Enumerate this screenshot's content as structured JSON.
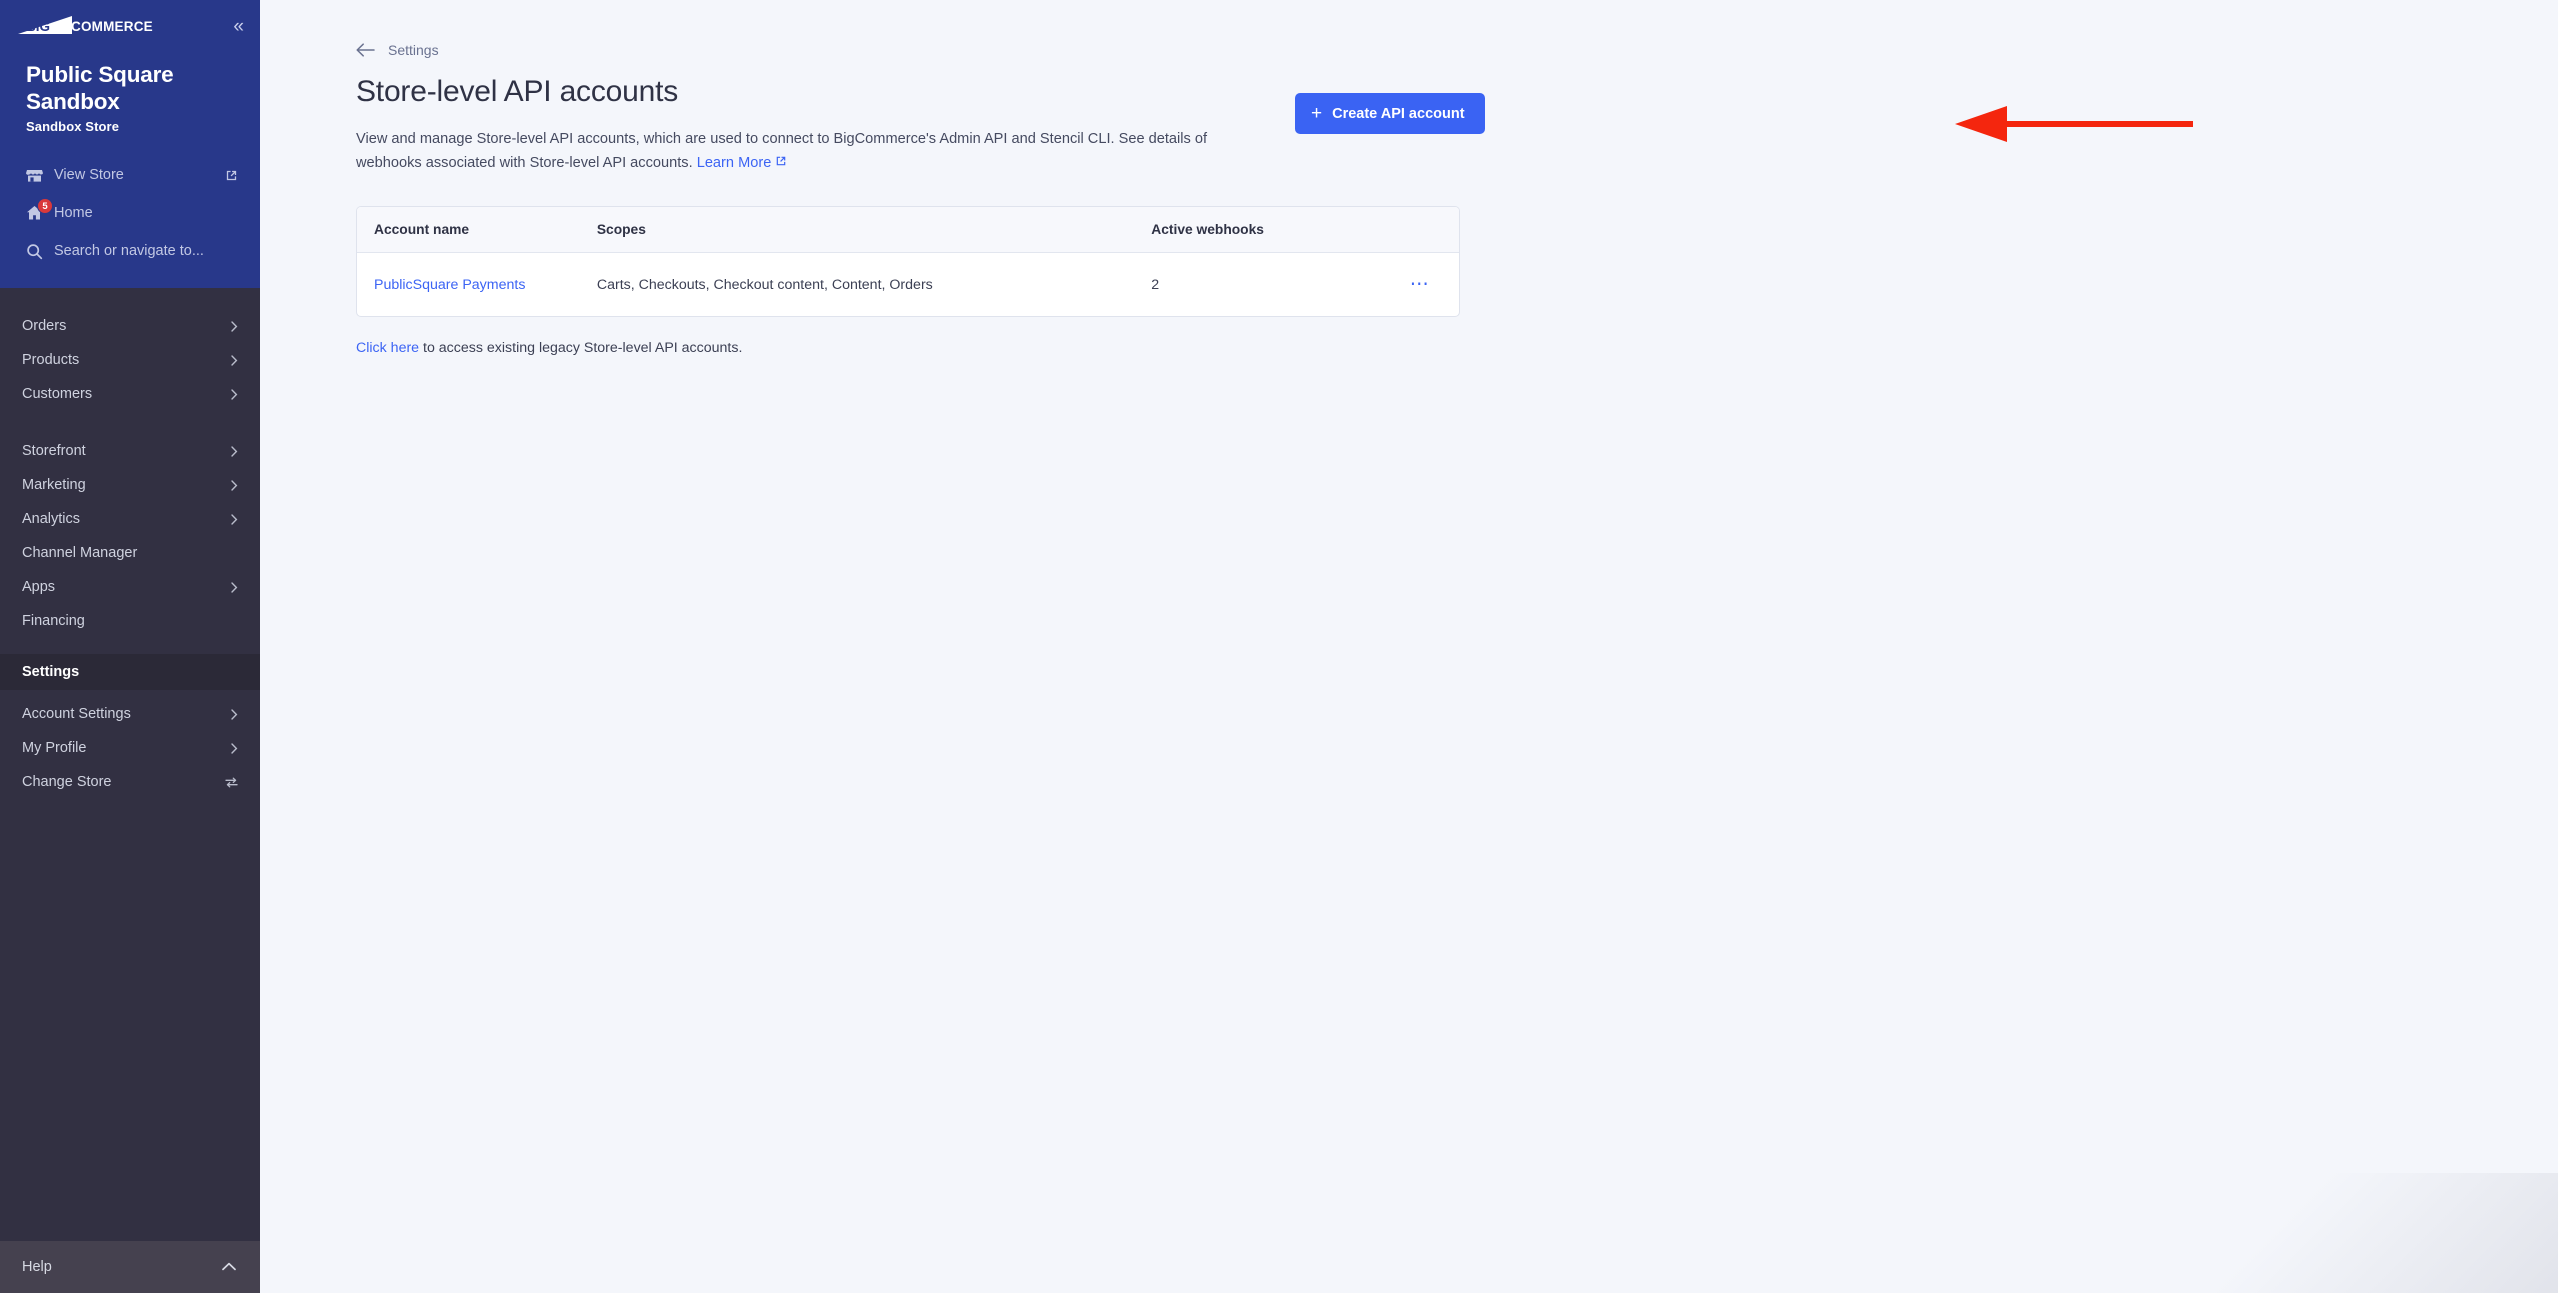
{
  "sidebar": {
    "logo_text": "BIGCOMMERCE",
    "collapse_label": "«",
    "store_name": "Public Square Sandbox",
    "store_type": "Sandbox Store",
    "quick_links": [
      {
        "label": "View Store",
        "icon": "store-icon",
        "external": true
      },
      {
        "label": "Home",
        "icon": "home-icon",
        "badge": "5"
      },
      {
        "label": "Search or navigate to...",
        "icon": "search-icon"
      }
    ],
    "nav_group_1": [
      {
        "label": "Orders",
        "chevron": true
      },
      {
        "label": "Products",
        "chevron": true
      },
      {
        "label": "Customers",
        "chevron": true
      }
    ],
    "nav_group_2": [
      {
        "label": "Storefront",
        "chevron": true
      },
      {
        "label": "Marketing",
        "chevron": true
      },
      {
        "label": "Analytics",
        "chevron": true
      },
      {
        "label": "Channel Manager",
        "chevron": false
      },
      {
        "label": "Apps",
        "chevron": true
      },
      {
        "label": "Financing",
        "chevron": false
      }
    ],
    "settings_header": "Settings",
    "nav_group_3": [
      {
        "label": "Account Settings",
        "chevron": true
      },
      {
        "label": "My Profile",
        "chevron": true
      },
      {
        "label": "Change Store",
        "chevron": false,
        "icon": "switch-icon"
      }
    ],
    "help_label": "Help",
    "help_chevron": "⌃"
  },
  "main": {
    "breadcrumb": "Settings",
    "page_title": "Store-level API accounts",
    "description_part1": "View and manage Store-level API accounts, which are used to connect to BigCommerce's Admin API and Stencil CLI. See details of webhooks associated with Store-level API accounts. ",
    "learn_more": "Learn More",
    "create_button": "Create API account",
    "create_button_icon": "plus-icon",
    "table": {
      "columns": [
        "Account name",
        "Scopes",
        "Active webhooks",
        ""
      ],
      "rows": [
        {
          "account_name": "PublicSquare Payments",
          "scopes": "Carts, Checkouts, Checkout content, Content, Orders",
          "active_webhooks": "2",
          "actions_icon": "ellipsis-icon"
        }
      ]
    },
    "legacy_link": "Click here",
    "legacy_text": " to access existing legacy Store-level API accounts."
  },
  "annotation": {
    "type": "arrow",
    "color": "#f4260e",
    "points_to": "create-api-account-button"
  },
  "colors": {
    "sidebar_top": "#28388a",
    "sidebar_body": "#323042",
    "sidebar_footer": "#45414f",
    "accent_blue": "#3a63f3",
    "link_blue": "#3c64f4",
    "canvas": "#f4f6fb",
    "badge_red": "#d9393b"
  }
}
